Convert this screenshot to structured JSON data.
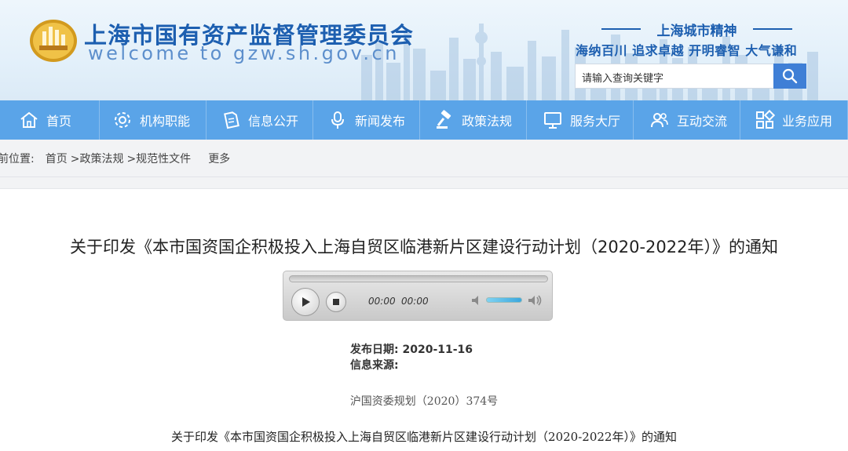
{
  "header": {
    "title": "上海市国有资产监督管理委员会",
    "subtitle": "welcome to gzw.sh.gov.cn",
    "spirit_title": "上海城市精神",
    "spirit_motto": "海纳百川 追求卓越 开明睿智 大气谦和",
    "search_placeholder": "请输入查询关键字"
  },
  "nav": [
    {
      "label": "首页",
      "icon": "home-icon"
    },
    {
      "label": "机构职能",
      "icon": "gear-icon"
    },
    {
      "label": "信息公开",
      "icon": "document-icon"
    },
    {
      "label": "新闻发布",
      "icon": "microphone-icon"
    },
    {
      "label": "政策法规",
      "icon": "gavel-icon"
    },
    {
      "label": "服务大厅",
      "icon": "monitor-icon"
    },
    {
      "label": "互动交流",
      "icon": "users-icon"
    },
    {
      "label": "业务应用",
      "icon": "apps-grid-icon"
    }
  ],
  "breadcrumb": {
    "prefix": "前位置:",
    "items": [
      "首页",
      ">政策法规",
      ">规范性文件"
    ],
    "more": "更多"
  },
  "article": {
    "title": "关于印发《本市国资国企积极投入上海自贸区临港新片区建设行动计划（2020-2022年）》的通知",
    "player": {
      "current_time": "00:00",
      "duration": "00:00"
    },
    "publish_date_label": "发布日期:",
    "publish_date": "2020-11-16",
    "source_label": "信息来源:",
    "doc_number": "沪国资委规划（2020）374号",
    "body_title": "关于印发《本市国资国企积极投入上海自贸区临港新片区建设行动计划（2020-2022年）》的通知"
  },
  "colors": {
    "brand": "#1d5fb0",
    "nav": "#5aa4e8",
    "search_button": "#3f7fd6"
  }
}
